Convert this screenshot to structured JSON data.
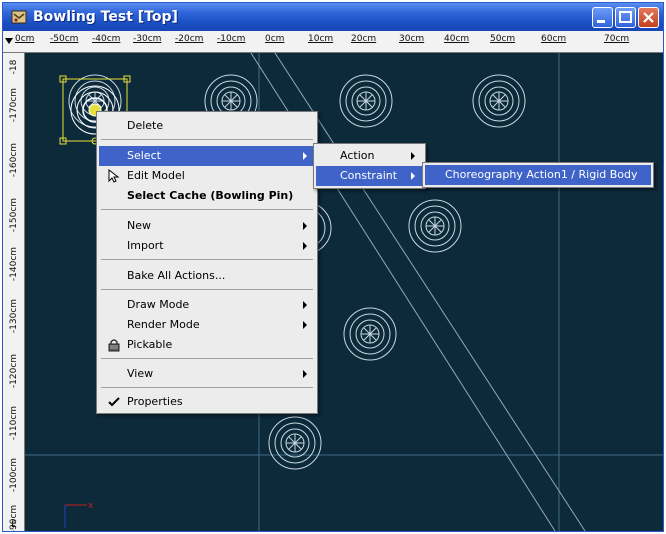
{
  "window": {
    "title": "Bowling Test [Top]",
    "icon": "app-icon",
    "controls": [
      "minimize-icon",
      "maximize-icon",
      "close-icon"
    ]
  },
  "ruler_top": {
    "ticks": [
      "0cm",
      "-50cm",
      "-40cm",
      "-30cm",
      "-20cm",
      "-10cm",
      "0cm",
      "10cm",
      "20cm",
      "30cm",
      "40cm",
      "50cm",
      "60cm",
      "70cm"
    ]
  },
  "ruler_left": {
    "ticks": [
      "-18",
      "-170cm",
      "-160cm",
      "-150cm",
      "-140cm",
      "-130cm",
      "-120cm",
      "-110cm",
      "-100cm",
      "-90cm",
      "E"
    ]
  },
  "context_menu": {
    "items": [
      {
        "label": "Delete"
      },
      {
        "label": "Select",
        "submenu": true,
        "highlighted": true
      },
      {
        "label": "Edit Model",
        "icon": "edit-cursor-icon"
      },
      {
        "label": "Select Cache (Bowling Pin)",
        "bold": true
      },
      {
        "label": "New",
        "submenu": true
      },
      {
        "label": "Import",
        "submenu": true
      },
      {
        "label": "Bake All Actions..."
      },
      {
        "label": "Draw Mode",
        "submenu": true
      },
      {
        "label": "Render Mode",
        "submenu": true
      },
      {
        "label": "Pickable",
        "icon": "lock-icon"
      },
      {
        "label": "View",
        "submenu": true
      },
      {
        "label": "Properties",
        "icon": "checkmark-icon"
      }
    ]
  },
  "submenu_select": {
    "items": [
      {
        "label": "Action",
        "submenu": true
      },
      {
        "label": "Constraint",
        "submenu": true,
        "highlighted": true
      }
    ]
  },
  "submenu_constraint": {
    "items": [
      {
        "label": "Choreography Action1 / Rigid Body",
        "highlighted": true
      }
    ]
  },
  "colors": {
    "viewport_bg": "#0d2a3a",
    "menu_highlight": "#3f63c8",
    "titlebar": "#1b4fc4",
    "axis_x": "#c02020",
    "axis_y": "#2040c0"
  }
}
